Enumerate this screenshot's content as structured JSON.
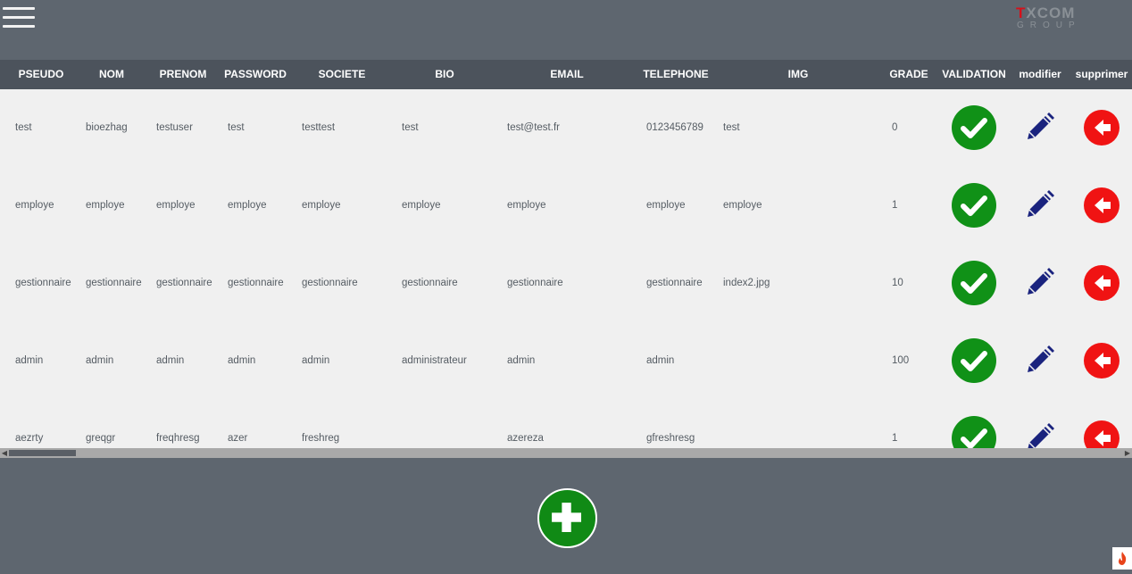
{
  "header": {
    "menu_icon": "hamburger-menu-icon",
    "logo": {
      "top_red": "T",
      "top_gray_1": "X",
      "top_gray_2": "COM",
      "bottom": "GROUP"
    }
  },
  "table": {
    "columns": [
      "PSEUDO",
      "NOM",
      "PRENOM",
      "PASSWORD",
      "SOCIETE",
      "BIO",
      "EMAIL",
      "TELEPHONE",
      "IMG",
      "GRADE",
      "VALIDATION",
      "modifier",
      "supprimer"
    ],
    "rows": [
      {
        "pseudo": "test",
        "nom": "bioezhag",
        "prenom": "testuser",
        "password": "test",
        "societe": "testtest",
        "bio": "test",
        "email": "test@test.fr",
        "telephone": "0123456789",
        "img": "test",
        "grade": "0"
      },
      {
        "pseudo": "employe",
        "nom": "employe",
        "prenom": "employe",
        "password": "employe",
        "societe": "employe",
        "bio": "employe",
        "email": "employe",
        "telephone": "employe",
        "img": "employe",
        "grade": "1"
      },
      {
        "pseudo": "gestionnaire",
        "nom": "gestionnaire",
        "prenom": "gestionnaire",
        "password": "gestionnaire",
        "societe": "gestionnaire",
        "bio": "gestionnaire",
        "email": "gestionnaire",
        "telephone": "gestionnaire",
        "img": "index2.jpg",
        "grade": "10"
      },
      {
        "pseudo": "admin",
        "nom": "admin",
        "prenom": "admin",
        "password": "admin",
        "societe": "admin",
        "bio": "administrateur",
        "email": "admin",
        "telephone": "admin",
        "img": "",
        "grade": "100"
      },
      {
        "pseudo": "aezrty",
        "nom": "greqgr",
        "prenom": "freqhresg",
        "password": "azer",
        "societe": "freshreg",
        "bio": "",
        "email": "azereza",
        "telephone": "gfreshresg",
        "img": "",
        "grade": "1"
      }
    ],
    "action_icons": {
      "validate": "check-circle-icon",
      "edit": "pencil-icon",
      "delete": "arrow-left-circle-icon"
    }
  },
  "footer": {
    "add_icon": "plus-circle-icon",
    "corner_icon": "flame-icon"
  },
  "colors": {
    "background": "#5e666f",
    "header_row": "#4c535c",
    "table_body": "#f0f0f0",
    "validate": "#109117",
    "edit": "#1a237e",
    "delete": "#f01313",
    "logo_red": "#d6101a"
  }
}
